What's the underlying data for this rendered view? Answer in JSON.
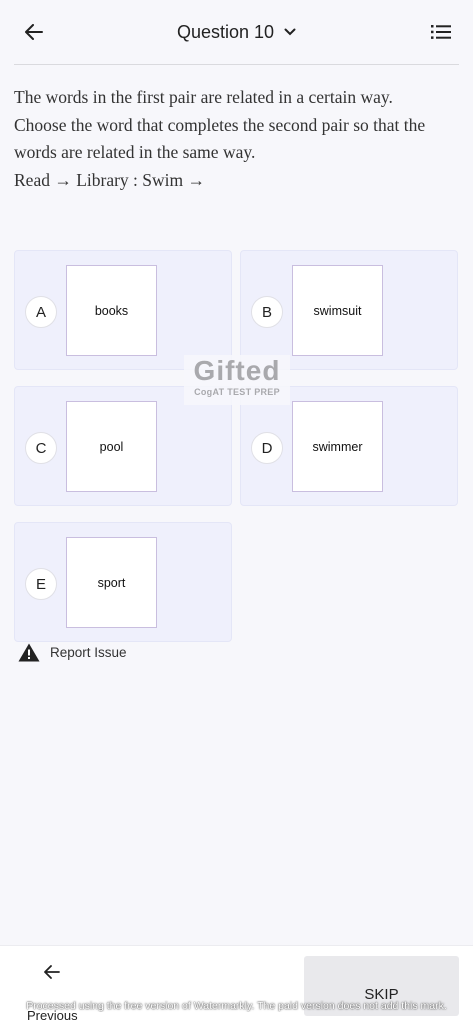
{
  "header": {
    "title": "Question 10",
    "back_icon": "arrow-left-icon",
    "dropdown_icon": "chevron-down-icon",
    "list_icon": "list-icon"
  },
  "question": {
    "line1": "The words in the first pair are related in a certain way.",
    "line2": "Choose the word that completes the second pair so that the",
    "line3": "words are related in the same way.",
    "line4": "Read → Library : Swim →"
  },
  "options": [
    {
      "letter": "A",
      "text": "books"
    },
    {
      "letter": "B",
      "text": "swimsuit"
    },
    {
      "letter": "C",
      "text": "pool"
    },
    {
      "letter": "D",
      "text": "swimmer"
    },
    {
      "letter": "E",
      "text": "sport"
    }
  ],
  "watermark": {
    "brand": "Gifted",
    "sub": "CogAT TEST PREP"
  },
  "report": {
    "label": "Report Issue",
    "icon": "warning-icon"
  },
  "bottom": {
    "previous_label": "Previous",
    "skip_label": "SKIP",
    "note": "Processed using the free version of Watermarkly. The paid version does not add this mark."
  },
  "colors": {
    "option_bg": "#eff0fc",
    "answer_border": "#c9bedf",
    "page_bg": "#f7f7fb"
  }
}
